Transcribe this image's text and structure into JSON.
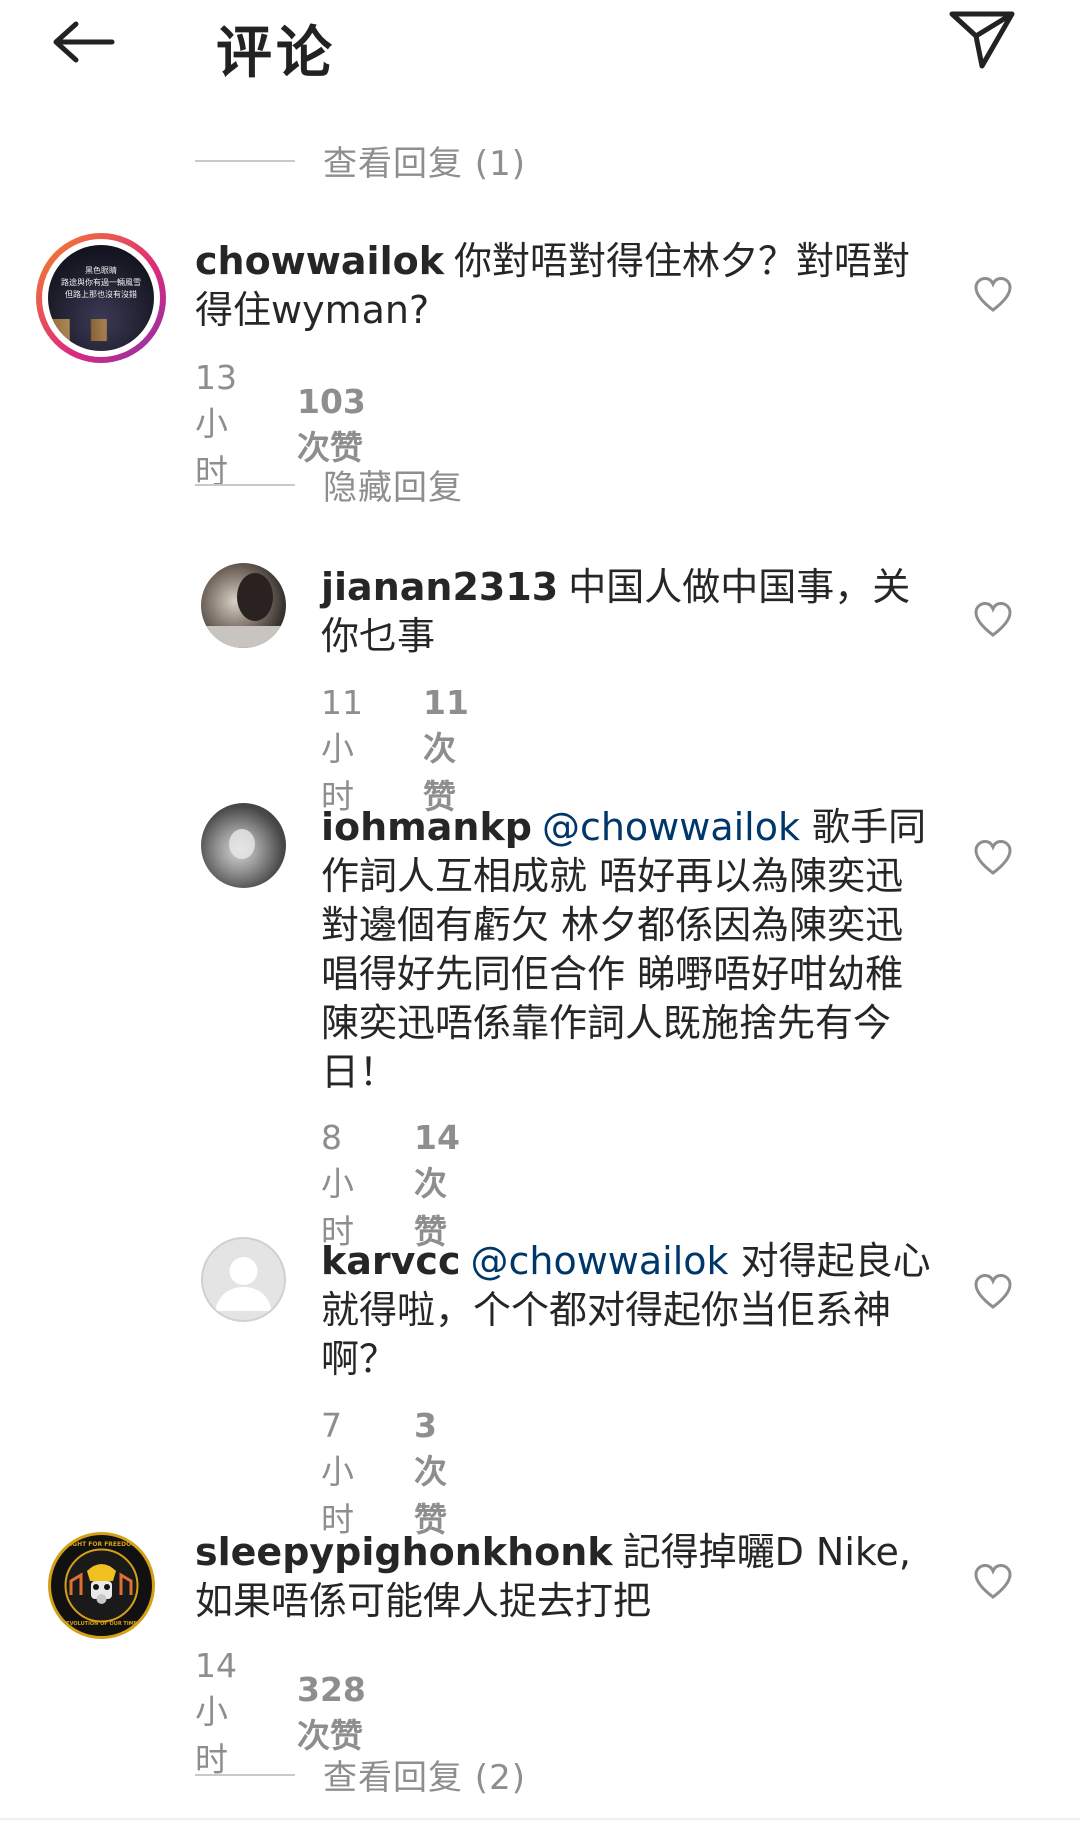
{
  "header": {
    "title": "评论",
    "back_icon": "arrow-left-icon",
    "send_icon": "paper-plane-icon"
  },
  "top_view_replies": "查看回复 (1)",
  "comments": [
    {
      "username": "chowwailok",
      "mention": "",
      "text": "你對唔對得住林夕？對唔對得住wyman?",
      "time": "13小时",
      "likes": "103次赞",
      "avatar_lines": [
        "黑色眼睛",
        "路途與你有過一輛風雪",
        "但路上那也沒有沒錯"
      ]
    },
    {
      "username": "jianan2313",
      "mention": "",
      "text": "中国人做中国事，关你乜事",
      "time": "11小时",
      "likes": "11次赞"
    },
    {
      "username": "iohmankp",
      "mention": "@chowwailok",
      "text": "歌手同作詞人互相成就 唔好再以為陳奕迅對邊個有虧欠 林夕都係因為陳奕迅唱得好先同佢合作 睇嘢唔好咁幼稚 陳奕迅唔係靠作詞人既施捨先有今日！",
      "time": "8小时",
      "likes": "14次赞"
    },
    {
      "username": "karvcc",
      "mention": "@chowwailok",
      "text": "对得起良心就得啦，个个都对得起你当佢系神啊？",
      "time": "7小时",
      "likes": "3次赞"
    },
    {
      "username": "sleepypighonkhonk",
      "mention": "",
      "text": "記得掉曬D Nike, 如果唔係可能俾人捉去打把",
      "time": "14小时",
      "likes": "328次赞",
      "avatar_lines": [
        "FIGHT FOR FREEDOM",
        "REVOLUTION OF OUR TIMES"
      ]
    }
  ],
  "hide_replies": "隐藏回复",
  "bottom_view_replies": "查看回复 (2)",
  "colors": {
    "text": "#262626",
    "meta": "#8e8e8e",
    "mention": "#00376b",
    "story_ring_start": "#f58529",
    "story_ring_end": "#dd2a7b"
  }
}
